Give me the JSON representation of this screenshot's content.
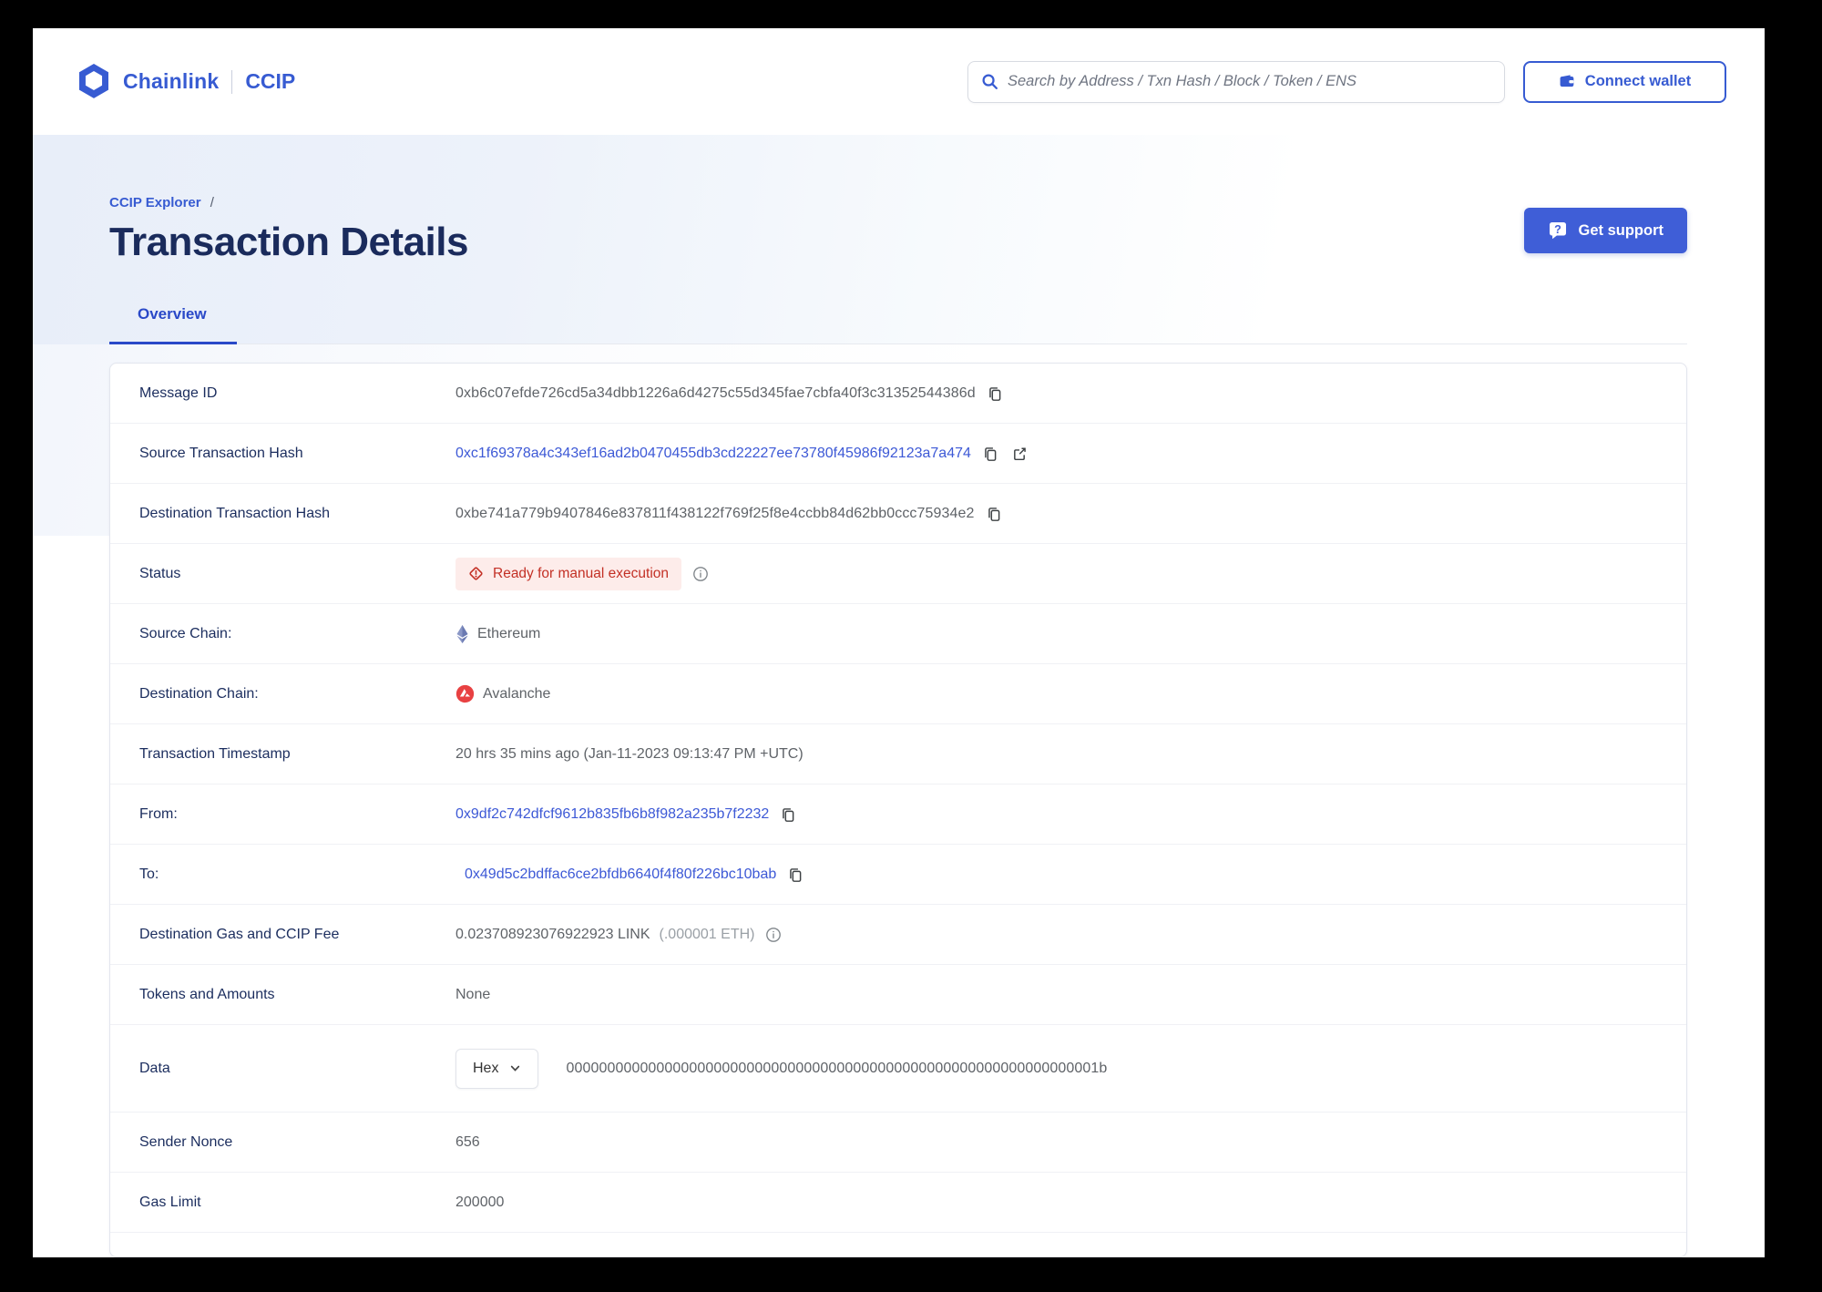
{
  "header": {
    "brand": "Chainlink",
    "product": "CCIP",
    "search_placeholder": "Search by Address / Txn Hash / Block / Token / ENS",
    "connect_wallet_label": "Connect wallet"
  },
  "hero": {
    "breadcrumb": "CCIP Explorer",
    "breadcrumb_separator": "/",
    "title": "Transaction Details",
    "get_support_label": "Get support"
  },
  "tabs": {
    "overview": "Overview"
  },
  "rows": {
    "message_id": {
      "label": "Message ID",
      "value": "0xb6c07efde726cd5a34dbb1226a6d4275c55d345fae7cbfa40f3c31352544386d"
    },
    "source_tx": {
      "label": "Source Transaction Hash",
      "value": "0xc1f69378a4c343ef16ad2b0470455db3cd22227ee73780f45986f92123a7a474"
    },
    "dest_tx": {
      "label": "Destination Transaction Hash",
      "value": "0xbe741a779b9407846e837811f438122f769f25f8e4ccbb84d62bb0ccc75934e2"
    },
    "status": {
      "label": "Status",
      "badge": "Ready for manual execution"
    },
    "source_chain": {
      "label": "Source Chain:",
      "value": "Ethereum"
    },
    "dest_chain": {
      "label": "Destination Chain:",
      "value": "Avalanche"
    },
    "timestamp": {
      "label": "Transaction Timestamp",
      "value": "20 hrs 35 mins ago (Jan-11-2023 09:13:47 PM +UTC)"
    },
    "from": {
      "label": "From:",
      "value": "0x9df2c742dfcf9612b835fb6b8f982a235b7f2232"
    },
    "to": {
      "label": "To:",
      "value": "0x49d5c2bdffac6ce2bfdb6640f4f80f226bc10bab"
    },
    "fee": {
      "label": "Destination Gas and CCIP Fee",
      "value": "0.023708923076922923 LINK",
      "secondary": "(.000001 ETH)"
    },
    "tokens": {
      "label": "Tokens and Amounts",
      "value": "None"
    },
    "data": {
      "label": "Data",
      "format": "Hex",
      "value": "00000000000000000000000000000000000000000000000000000000000000001b"
    },
    "sender_nonce": {
      "label": "Sender Nonce",
      "value": "656"
    },
    "gas_limit": {
      "label": "Gas Limit",
      "value": "200000"
    }
  },
  "icons": {
    "logo": "chainlink-hexagon",
    "search": "magnifier",
    "wallet": "wallet",
    "support": "question-chat-bubble",
    "copy": "copy-pages",
    "external": "external-link-arrow",
    "info": "circled-i",
    "status": "diamond-exclamation",
    "source_chain": "ethereum-diamond",
    "dest_chain": "avalanche-circle",
    "hex_chevron": "chevron-down"
  },
  "colors": {
    "accent": "#375bd2",
    "title_navy": "#1a2b5c",
    "label_navy": "#1b2d5e",
    "value_gray": "#5f6368",
    "link_blue": "#3d59d6",
    "status_red": "#c33025",
    "status_bg": "#fdecea",
    "avalanche_red": "#e84142",
    "hero_tint": "#e8eef9"
  }
}
